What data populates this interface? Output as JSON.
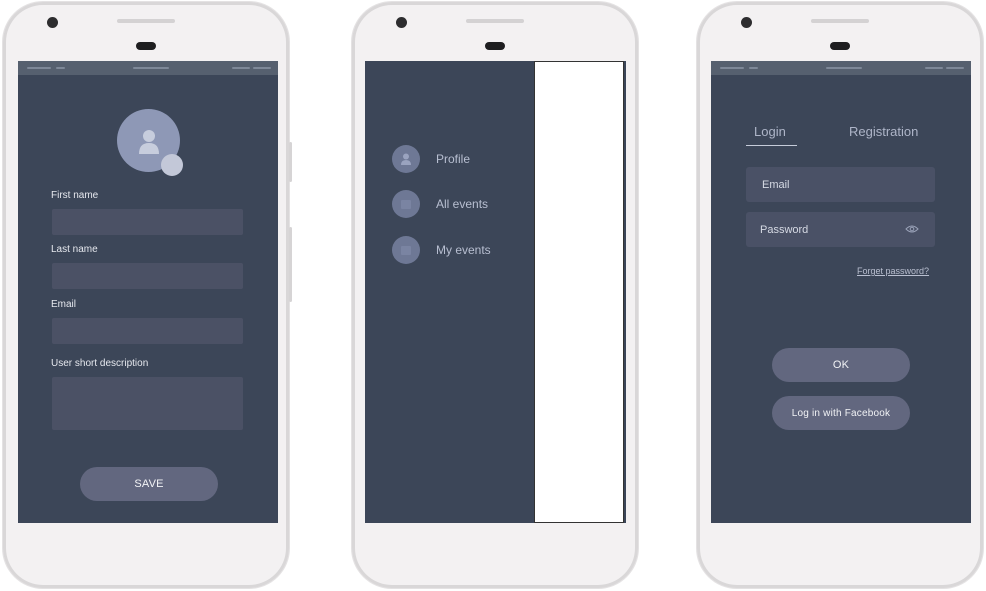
{
  "colors": {
    "screen_bg": "#3c4658",
    "input_bg": "#4b5165",
    "button_bg": "#62677f",
    "avatar_bg": "#8e98b6",
    "phone_body": "#f3f1f2"
  },
  "profile_screen": {
    "first_name_label": "First name",
    "last_name_label": "Last name",
    "email_label": "Email",
    "description_label": "User short description",
    "save_label": "SAVE",
    "avatar_icon": "user-icon"
  },
  "menu_screen": {
    "items": [
      {
        "label": "Profile",
        "icon": "user-icon"
      },
      {
        "label": "All events",
        "icon": "events-icon"
      },
      {
        "label": "My events",
        "icon": "my-events-icon"
      }
    ]
  },
  "login_screen": {
    "tabs": [
      {
        "label": "Login",
        "active": true
      },
      {
        "label": "Registration",
        "active": false
      }
    ],
    "email_placeholder": "Email",
    "password_placeholder": "Password",
    "show_password_icon": "eye-icon",
    "forgot_password": "Forget password?",
    "ok_label": "OK",
    "facebook_label": "Log in with Facebook"
  }
}
